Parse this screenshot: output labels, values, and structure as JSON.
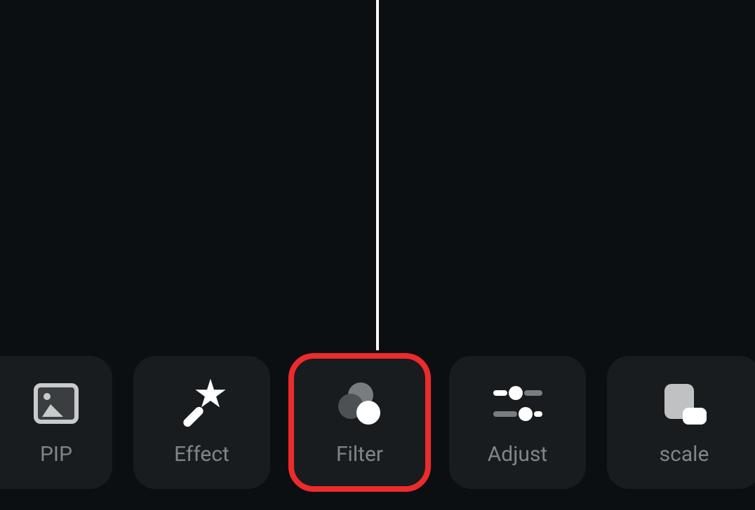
{
  "toolbar": {
    "items": [
      {
        "label": "PIP",
        "icon": "pip-icon"
      },
      {
        "label": "Effect",
        "icon": "effect-icon"
      },
      {
        "label": "Filter",
        "icon": "filter-icon",
        "highlighted": true
      },
      {
        "label": "Adjust",
        "icon": "adjust-icon"
      },
      {
        "label": "scale",
        "icon": "scale-icon"
      }
    ]
  },
  "colors": {
    "background": "#0b0f12",
    "button_bg": "#181c1f",
    "label": "#808589",
    "highlight": "#ed2b2b",
    "playhead": "#ffffff"
  }
}
